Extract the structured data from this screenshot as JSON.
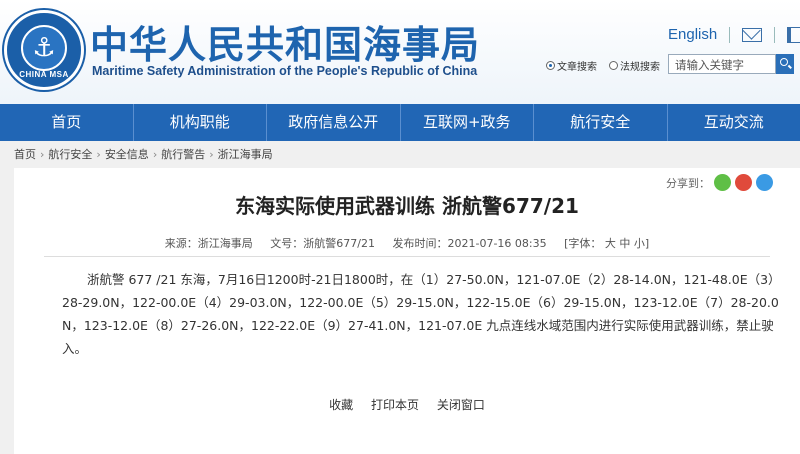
{
  "header": {
    "org_cn": "中华人民共和国海事局",
    "org_en": "Maritime Safety Administration of the People's Republic of China",
    "logo_text": "CHINA MSA",
    "lang_link": "English",
    "icons": [
      "anchor-icon",
      "mail-icon",
      "book-icon",
      "search-icon"
    ],
    "search": {
      "option_article": "文章搜索",
      "option_regulation": "法规搜索",
      "selected": "文章搜索",
      "placeholder": "请输入关键字"
    }
  },
  "nav": {
    "items": [
      "首页",
      "机构职能",
      "政府信息公开",
      "互联网+政务",
      "航行安全",
      "互动交流"
    ]
  },
  "breadcrumb": [
    "首页",
    "航行安全",
    "安全信息",
    "航行警告",
    "浙江海事局"
  ],
  "article": {
    "title": "东海实际使用武器训练 浙航警677/21",
    "share_label": "分享到：",
    "meta": {
      "source": "来源：浙江海事局",
      "doc_no": "文号：浙航警677/21",
      "time": "发布时间：2021-07-16 08:35",
      "font_size": "[字体：  大  中  小]"
    },
    "body": "浙航警 677 /21 东海，7月16日1200时-21日1800时，在（1）27-50.0N，121-07.0E（2）28-14.0N，121-48.0E（3）28-29.0N，122-00.0E（4）29-03.0N，122-00.0E（5）29-15.0N，122-15.0E（6）29-15.0N，123-12.0E（7）28-20.0N，123-12.0E（8）27-26.0N，122-22.0E（9）27-41.0N，121-07.0E 九点连线水域范围内进行实际使用武器训练，禁止驶入。",
    "actions": [
      "收藏",
      "打印本页",
      "关闭窗口"
    ]
  },
  "colors": {
    "brand_blue": "#2166b5",
    "title_blue": "#1e64ae",
    "page_bg": "#f0f0f0"
  }
}
